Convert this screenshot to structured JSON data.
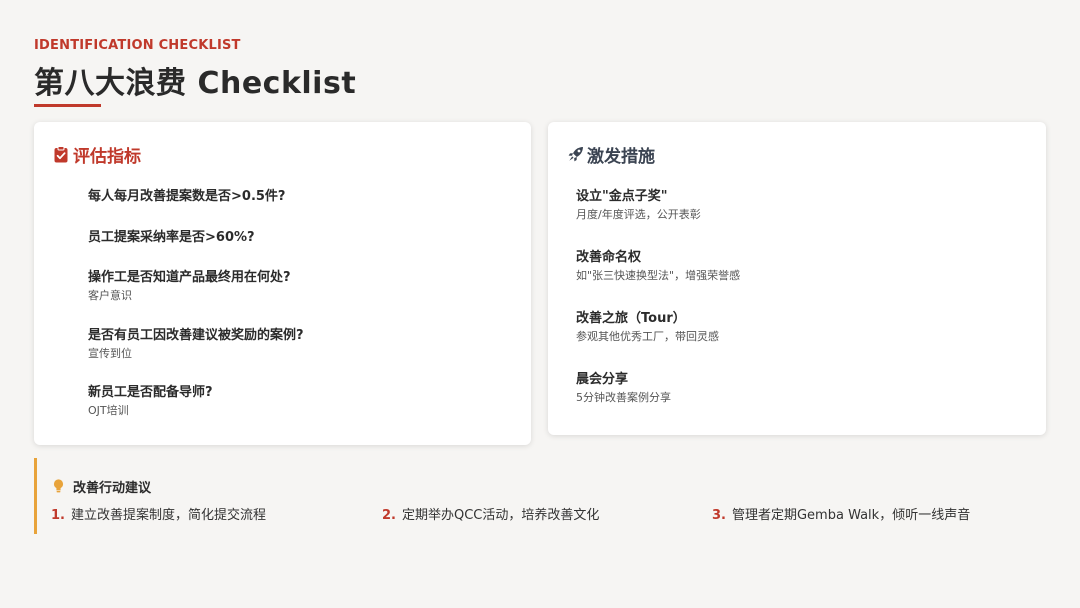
{
  "header": {
    "eyebrow": "IDENTIFICATION CHECKLIST",
    "title": "第八大浪费 Checklist",
    "accent_color": "#c0392b"
  },
  "evaluation": {
    "heading": "评估指标",
    "icon": "clipboard-check-icon",
    "items": [
      {
        "title": "每人每月改善提案数是否>0.5件?",
        "sub": ""
      },
      {
        "title": "员工提案采纳率是否>60%?",
        "sub": ""
      },
      {
        "title": "操作工是否知道产品最终用在何处?",
        "sub": "客户意识"
      },
      {
        "title": "是否有员工因改善建议被奖励的案例?",
        "sub": "宣传到位"
      },
      {
        "title": "新员工是否配备导师?",
        "sub": "OJT培训"
      }
    ]
  },
  "measures": {
    "heading": "激发措施",
    "icon": "rocket-icon",
    "items": [
      {
        "title": "设立\"金点子奖\"",
        "sub": "月度/年度评选，公开表彰"
      },
      {
        "title": "改善命名权",
        "sub": "如\"张三快速换型法\"，增强荣誉感"
      },
      {
        "title": "改善之旅（Tour）",
        "sub": "参观其他优秀工厂，带回灵感"
      },
      {
        "title": "晨会分享",
        "sub": "5分钟改善案例分享"
      }
    ]
  },
  "actions": {
    "heading": "改善行动建议",
    "icon": "lightbulb-icon",
    "accent_color": "#e8a33a",
    "items": [
      {
        "num": "1.",
        "text": "建立改善提案制度，简化提交流程"
      },
      {
        "num": "2.",
        "text": "定期举办QCC活动，培养改善文化"
      },
      {
        "num": "3.",
        "text": "管理者定期Gemba Walk，倾听一线声音"
      }
    ]
  }
}
